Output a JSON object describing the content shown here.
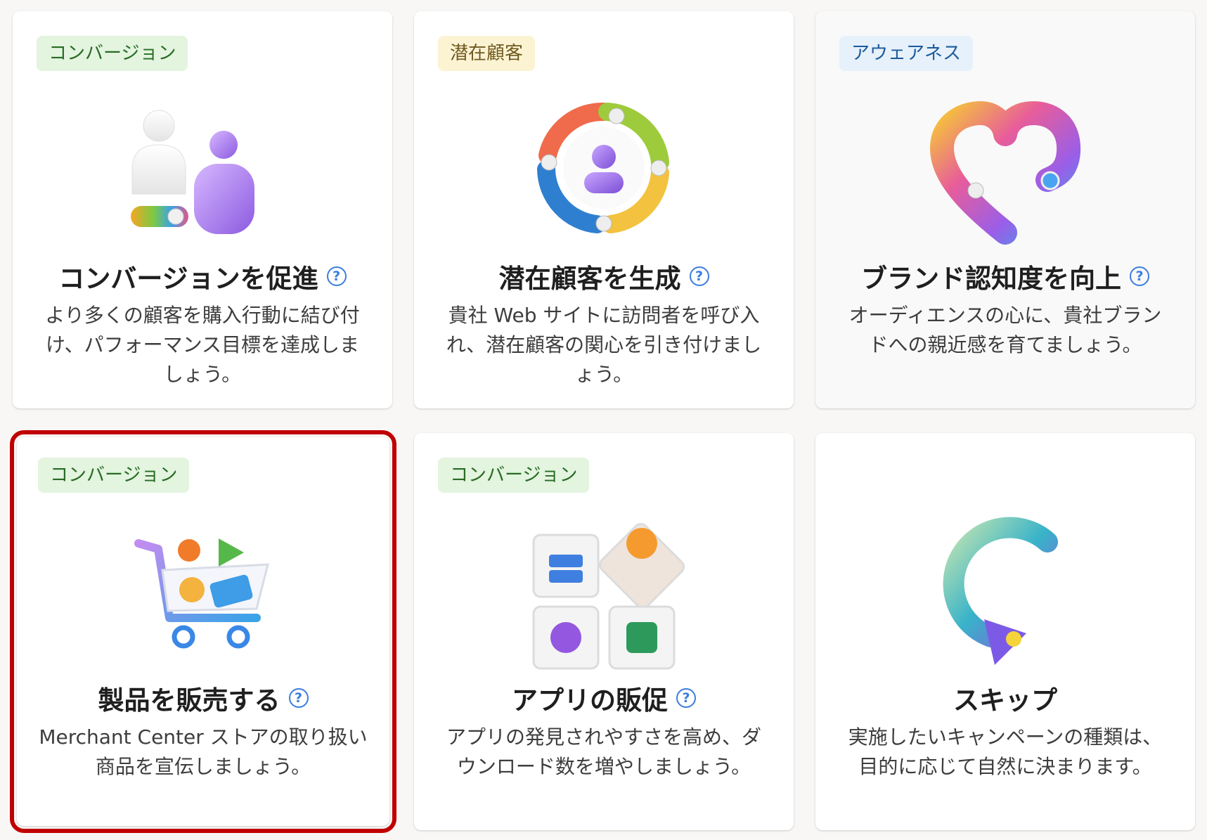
{
  "cards": [
    {
      "badge": "コンバージョン",
      "title": "コンバージョンを促進",
      "description": "より多くの顧客を購入行動に結び付け、パフォーマンス目標を達成しましょう。",
      "icon": "people-conversion-icon"
    },
    {
      "badge": "潜在顧客",
      "title": "潜在顧客を生成",
      "description": "貴社 Web サイトに訪問者を呼び入れ、潜在顧客の関心を引き付けましょう。",
      "icon": "lead-cycle-icon"
    },
    {
      "badge": "アウェアネス",
      "title": "ブランド認知度を向上",
      "description": "オーディエンスの心に、貴社ブランドへの親近感を育てましょう。",
      "icon": "heart-icon"
    },
    {
      "badge": "コンバージョン",
      "title": "製品を販売する",
      "description": "Merchant Center ストアの取り扱い商品を宣伝しましょう。",
      "icon": "shopping-cart-icon",
      "selected": true
    },
    {
      "badge": "コンバージョン",
      "title": "アプリの販促",
      "description": "アプリの発見されやすさを高め、ダウンロード数を増やしましょう。",
      "icon": "app-tiles-icon"
    },
    {
      "title": "スキップ",
      "description": "実施したいキャンペーンの種類は、目的に応じて自然に決まります。",
      "icon": "skip-arrow-icon"
    }
  ],
  "help_symbol": "?",
  "colors": {
    "selected_outline": "#c00000",
    "help": "#3b7de0"
  }
}
